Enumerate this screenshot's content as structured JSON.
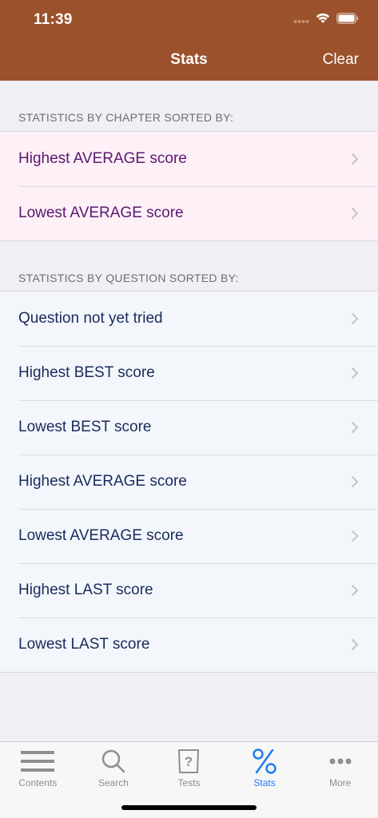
{
  "status_bar": {
    "time": "11:39"
  },
  "nav": {
    "title": "Stats",
    "clear_label": "Clear"
  },
  "chapter_section": {
    "header": "STATISTICS BY CHAPTER SORTED BY:",
    "items": [
      {
        "label": "Highest AVERAGE score"
      },
      {
        "label": "Lowest AVERAGE score"
      }
    ]
  },
  "question_section": {
    "header": "STATISTICS BY QUESTION SORTED BY:",
    "items": [
      {
        "label": "Question not yet tried"
      },
      {
        "label": "Highest BEST score"
      },
      {
        "label": "Lowest BEST score"
      },
      {
        "label": "Highest AVERAGE score"
      },
      {
        "label": "Lowest AVERAGE score"
      },
      {
        "label": "Highest LAST score"
      },
      {
        "label": "Lowest LAST score"
      }
    ]
  },
  "tabbar": {
    "tabs": [
      {
        "label": "Contents",
        "icon": "list-icon"
      },
      {
        "label": "Search",
        "icon": "search-icon"
      },
      {
        "label": "Tests",
        "icon": "question-card-icon"
      },
      {
        "label": "Stats",
        "icon": "percent-icon",
        "active": true
      },
      {
        "label": "More",
        "icon": "more-dots-icon"
      }
    ]
  },
  "colors": {
    "header_bg": "#9b512b",
    "chapter_bg": "#fef0f7",
    "chapter_text": "#5a1870",
    "question_bg": "#f3f7fb",
    "question_text": "#1a2a5c",
    "active_tab": "#1c7cf2",
    "inactive_tab": "#8e8e93"
  }
}
